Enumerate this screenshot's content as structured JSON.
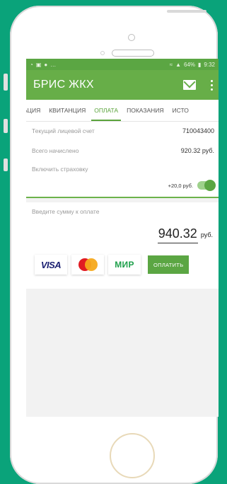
{
  "status_bar": {
    "signal": "64%",
    "time": "9:32"
  },
  "app": {
    "title": "БРИС ЖКХ"
  },
  "tabs": [
    {
      "label": "ация"
    },
    {
      "label": "Квитанция"
    },
    {
      "label": "Оплата",
      "active": true
    },
    {
      "label": "Показания"
    },
    {
      "label": "Исто"
    }
  ],
  "account": {
    "account_label": "Текущий лицевой счет",
    "account_value": "710043400",
    "charged_label": "Всего начислено",
    "charged_value": "920.32 руб.",
    "insurance_label": "Включить страховку",
    "insurance_amount": "+20,0 руб.",
    "insurance_enabled": true
  },
  "payment": {
    "prompt": "Введите сумму к оплате",
    "amount": "940.32",
    "currency": "руб.",
    "methods": [
      "VISA",
      "Mastercard",
      "МИР"
    ],
    "pay_button": "ОПЛАТИТЬ"
  },
  "colors": {
    "green": "#67ae48",
    "accent": "#5aa33b",
    "background": "#0aa37a"
  }
}
